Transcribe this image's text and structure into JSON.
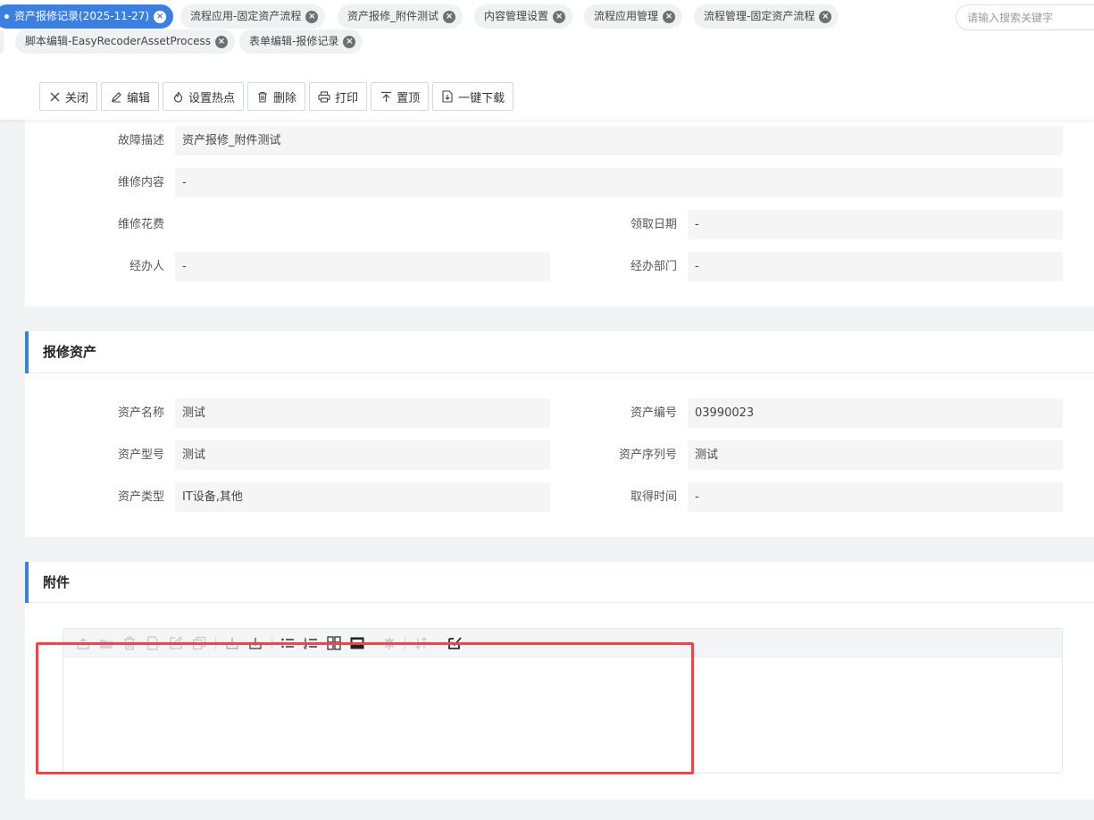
{
  "tabs": [
    {
      "label": "资产报修记录(2025-11-27)",
      "active": true
    },
    {
      "label": "流程应用-固定资产流程"
    },
    {
      "label": "资产报修_附件测试"
    },
    {
      "label": "内容管理设置"
    },
    {
      "label": "流程应用管理"
    },
    {
      "label": "流程管理-固定资产流程"
    },
    {
      "label": "脚本编辑-EasyRecoderAssetProcess"
    },
    {
      "label": "表单编辑-报修记录"
    }
  ],
  "search": {
    "placeholder": "请输入搜索关键字"
  },
  "toolbar": {
    "close": "关闭",
    "edit": "编辑",
    "hotspot": "设置热点",
    "delete": "删除",
    "print": "打印",
    "pin": "置顶",
    "download": "一键下载"
  },
  "repair": {
    "fault_label": "故障描述",
    "fault_value": "资产报修_附件测试",
    "content_label": "维修内容",
    "content_value": "-",
    "cost_label": "维修花费",
    "receive_date_label": "领取日期",
    "receive_date_value": "-",
    "handler_label": "经办人",
    "handler_value": "-",
    "dept_label": "经办部门",
    "dept_value": "-"
  },
  "asset": {
    "title": "报修资产",
    "name_label": "资产名称",
    "name_value": "测试",
    "code_label": "资产编号",
    "code_value": "03990023",
    "model_label": "资产型号",
    "model_value": "测试",
    "serial_label": "资产序列号",
    "serial_value": "测试",
    "type_label": "资产类型",
    "type_value": "IT设备,其他",
    "acquire_label": "取得时间",
    "acquire_value": "-"
  },
  "attachment": {
    "title": "附件",
    "toolbar_icons": [
      "upload-icon",
      "folder-icon",
      "trash-icon",
      "file-icon",
      "edit-external-icon",
      "copy-icon",
      "download-icon",
      "download-all-icon",
      "list-icon",
      "numbered-list-icon",
      "grid-icon",
      "image-view-icon",
      "settings-icon",
      "sort-icon",
      "select-icon"
    ]
  },
  "colors": {
    "accent": "#3b7fe0",
    "highlight": "#e8474e"
  }
}
